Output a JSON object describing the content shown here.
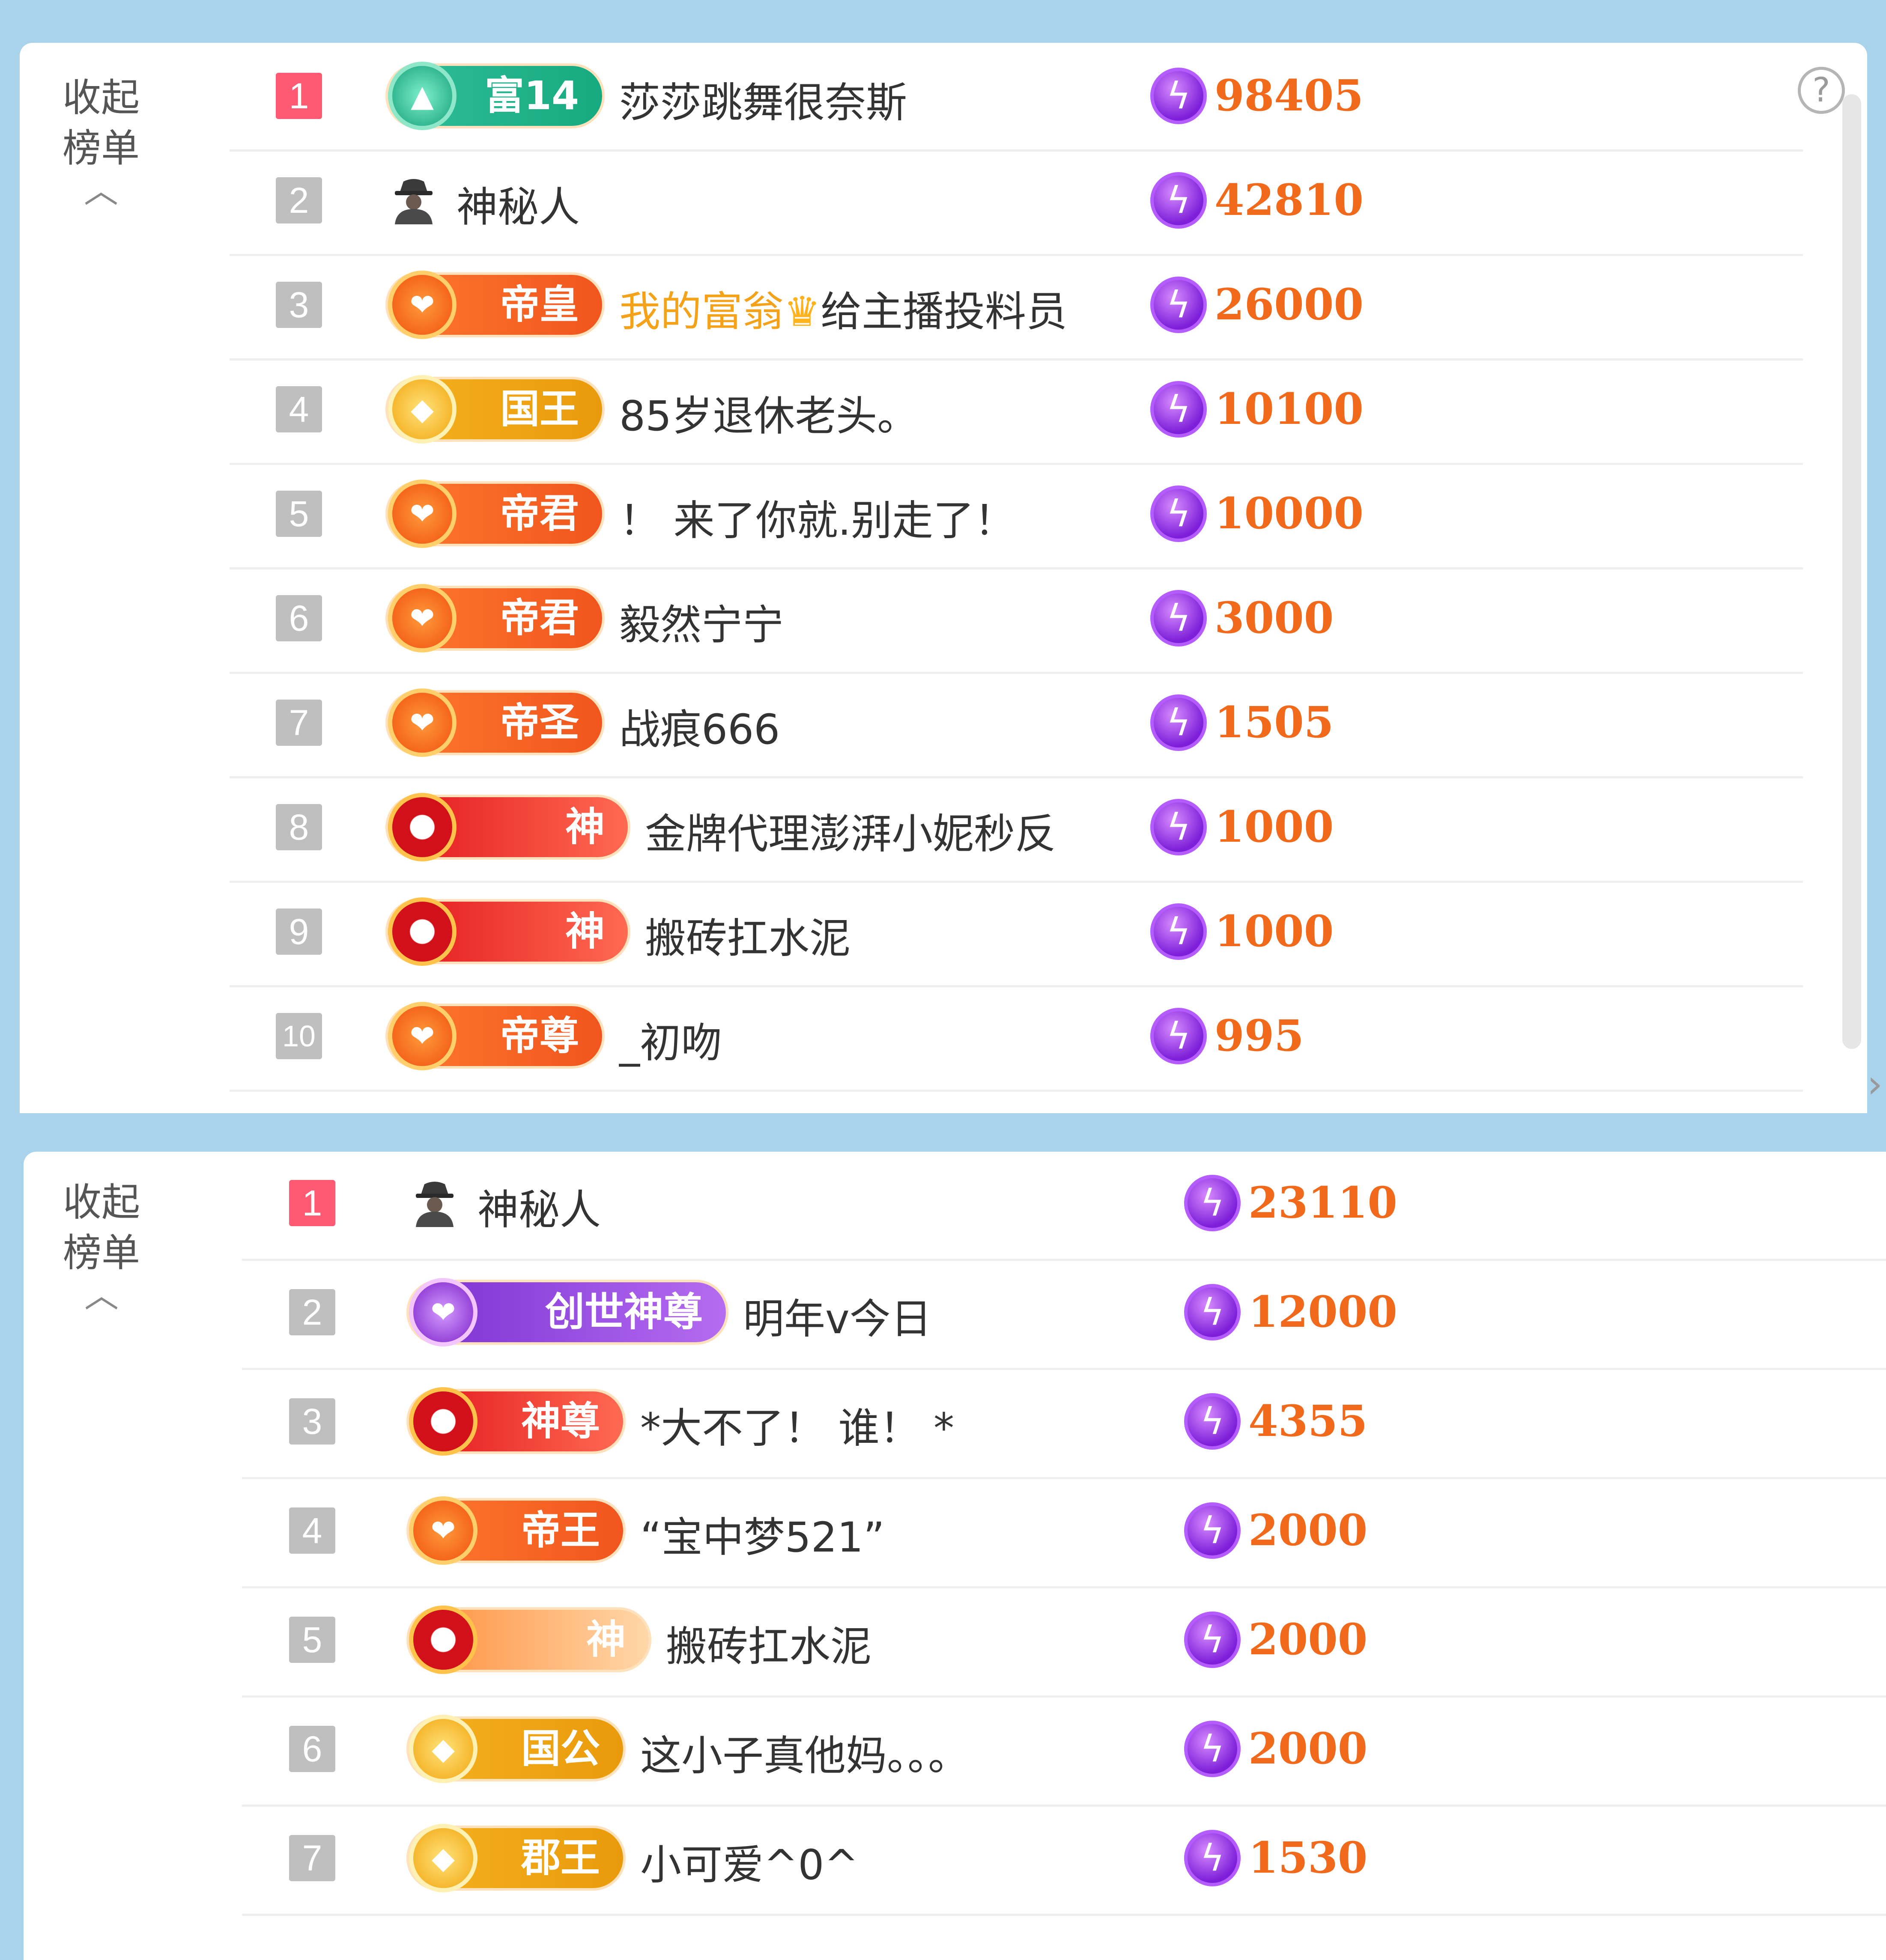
{
  "labels": {
    "collapse_line1": "收起",
    "collapse_line2": "榜单",
    "help": "?"
  },
  "icons": {
    "coin": "lightning-coin-icon",
    "chevron_up": "chevron-up-icon",
    "mystery": "mystery-user-icon",
    "crown": "crown-icon"
  },
  "top_list": [
    {
      "rank": "1",
      "badge": "富14",
      "badge_style": "teal",
      "name": "莎莎跳舞很奈斯",
      "amount": "98405"
    },
    {
      "rank": "2",
      "badge": "",
      "badge_style": "none",
      "name": "神秘人",
      "amount": "42810",
      "mystery": true
    },
    {
      "rank": "3",
      "badge": "帝皇",
      "badge_style": "orange",
      "name": "我的富翁",
      "name_suffix": "给主播投料员",
      "crown": true,
      "amount": "26000"
    },
    {
      "rank": "4",
      "badge": "国王",
      "badge_style": "gold",
      "name": "85岁退休老头。",
      "amount": "10100"
    },
    {
      "rank": "5",
      "badge": "帝君",
      "badge_style": "orange",
      "name": "！ 来了你就.别走了！",
      "amount": "10000"
    },
    {
      "rank": "6",
      "badge": "帝君",
      "badge_style": "orange",
      "name": "毅然宁宁",
      "amount": "3000"
    },
    {
      "rank": "7",
      "badge": "帝圣",
      "badge_style": "orange",
      "name": "战痕666",
      "amount": "1505"
    },
    {
      "rank": "8",
      "badge": "神",
      "badge_style": "red",
      "name": "金牌代理澎湃小妮秒反",
      "amount": "1000"
    },
    {
      "rank": "9",
      "badge": "神",
      "badge_style": "red",
      "name": "搬砖扛水泥",
      "amount": "1000"
    },
    {
      "rank": "10",
      "badge": "帝尊",
      "badge_style": "orange",
      "name": "_初吻",
      "amount": "995"
    }
  ],
  "bottom_list": [
    {
      "rank": "1",
      "badge": "",
      "badge_style": "none",
      "name": "神秘人",
      "amount": "23110",
      "mystery": true
    },
    {
      "rank": "2",
      "badge": "创世神尊",
      "badge_style": "purple",
      "name": "明年v今日",
      "amount": "12000"
    },
    {
      "rank": "3",
      "badge": "神尊",
      "badge_style": "red",
      "name": "*大不了！ 谁！ *",
      "amount": "4355"
    },
    {
      "rank": "4",
      "badge": "帝王",
      "badge_style": "orange",
      "name": "“宝中梦521”",
      "amount": "2000"
    },
    {
      "rank": "5",
      "badge": "神",
      "badge_style": "flame",
      "name": "搬砖扛水泥",
      "amount": "2000"
    },
    {
      "rank": "6",
      "badge": "国公",
      "badge_style": "gold",
      "name": "这小子真他妈。。。",
      "amount": "2000"
    },
    {
      "rank": "7",
      "badge": "郡王",
      "badge_style": "gold",
      "name": "小可爱^0^",
      "amount": "1530"
    }
  ]
}
